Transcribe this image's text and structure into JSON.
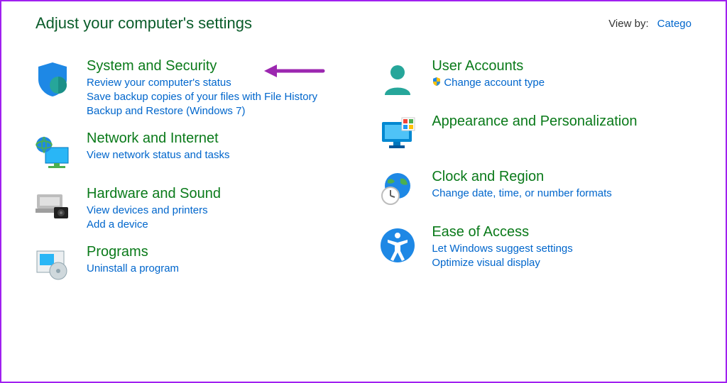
{
  "header": {
    "title": "Adjust your computer's settings",
    "view_by_label": "View by:",
    "view_by_value": "Catego"
  },
  "left_categories": [
    {
      "title": "System and Security",
      "links": [
        "Review your computer's status",
        "Save backup copies of your files with File History",
        "Backup and Restore (Windows 7)"
      ]
    },
    {
      "title": "Network and Internet",
      "links": [
        "View network status and tasks"
      ]
    },
    {
      "title": "Hardware and Sound",
      "links": [
        "View devices and printers",
        "Add a device"
      ]
    },
    {
      "title": "Programs",
      "links": [
        "Uninstall a program"
      ]
    }
  ],
  "right_categories": [
    {
      "title": "User Accounts",
      "links": [
        {
          "text": "Change account type",
          "shield": true
        }
      ]
    },
    {
      "title": "Appearance and Personalization",
      "links": []
    },
    {
      "title": "Clock and Region",
      "links": [
        "Change date, time, or number formats"
      ]
    },
    {
      "title": "Ease of Access",
      "links": [
        "Let Windows suggest settings",
        "Optimize visual display"
      ]
    }
  ]
}
